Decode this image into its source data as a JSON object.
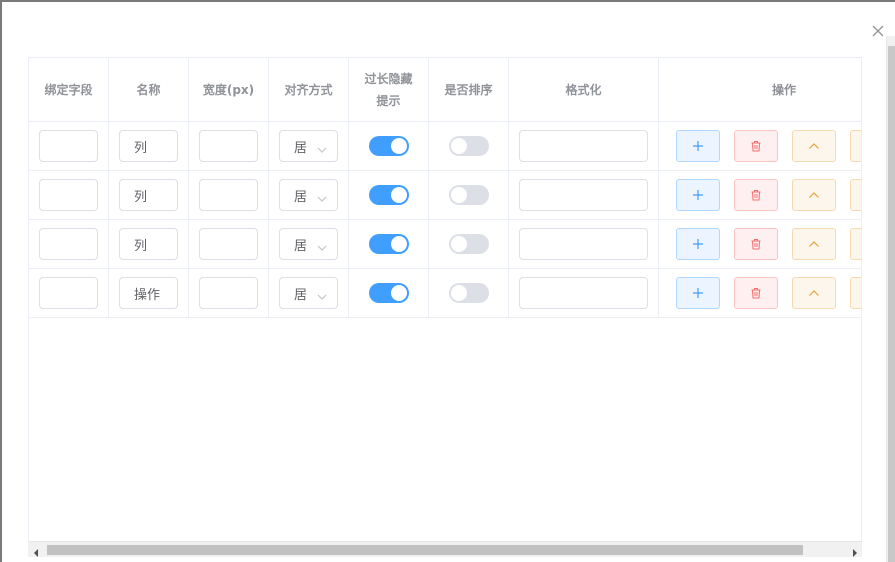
{
  "dialog": {
    "close_icon": "close-icon"
  },
  "table": {
    "headers": {
      "field": "绑定字段",
      "name": "名称",
      "width": "宽度(px)",
      "align": "对齐方式",
      "overflow_line1": "过长隐藏",
      "overflow_line2": "提示",
      "sortable": "是否排序",
      "format": "格式化",
      "ops": "操作"
    },
    "rows": [
      {
        "field": "",
        "name": "列",
        "width": "",
        "align": "居",
        "overflow_tooltip": true,
        "sortable": false,
        "format": ""
      },
      {
        "field": "",
        "name": "列",
        "width": "",
        "align": "居",
        "overflow_tooltip": true,
        "sortable": false,
        "format": ""
      },
      {
        "field": "",
        "name": "列",
        "width": "",
        "align": "居",
        "overflow_tooltip": true,
        "sortable": false,
        "format": ""
      },
      {
        "field": "",
        "name": "操作",
        "width": "",
        "align": "居",
        "overflow_tooltip": true,
        "sortable": false,
        "format": ""
      }
    ]
  },
  "colors": {
    "primary": "#409eff",
    "danger": "#f56c6c",
    "warning": "#e6a23c",
    "switch_off": "#dcdfe6"
  },
  "icons": [
    "plus-icon",
    "trash-icon",
    "chevron-up-icon",
    "chevron-down-icon",
    "close-icon"
  ]
}
